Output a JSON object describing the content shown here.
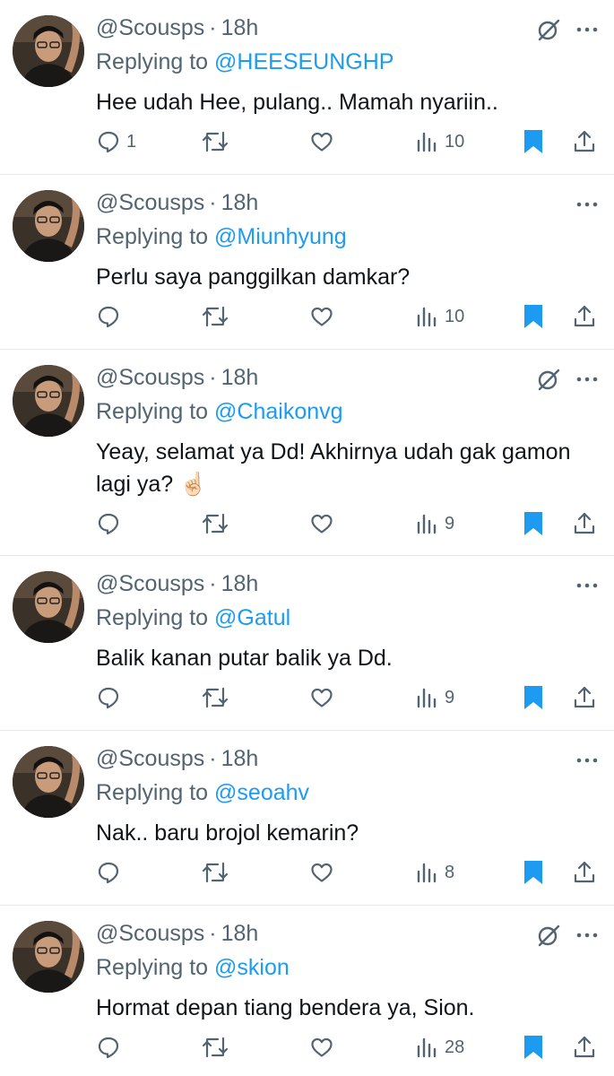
{
  "colors": {
    "accent": "#1d9bf0",
    "muted": "#536471",
    "text": "#0f1419",
    "divider": "#e6e9eb"
  },
  "icons": [
    "reply-icon",
    "retweet-icon",
    "like-icon",
    "views-icon",
    "bookmark-icon",
    "share-icon",
    "grok-icon",
    "more-icon"
  ],
  "tweets": [
    {
      "handle": "@Scousps",
      "sep": "·",
      "time": "18h",
      "replying_prefix": "Replying to",
      "replying_to": "@HEESEUNGHP",
      "text": "Hee udah Hee, pulang.. Mamah nyariin..",
      "replies": "1",
      "retweets": "",
      "likes": "",
      "views": "10",
      "bookmarked": true,
      "show_grok": true
    },
    {
      "handle": "@Scousps",
      "sep": "·",
      "time": "18h",
      "replying_prefix": "Replying to",
      "replying_to": "@Miunhyung",
      "text": "Perlu saya panggilkan damkar?",
      "replies": "",
      "retweets": "",
      "likes": "",
      "views": "10",
      "bookmarked": true,
      "show_grok": false
    },
    {
      "handle": "@Scousps",
      "sep": "·",
      "time": "18h",
      "replying_prefix": "Replying to",
      "replying_to": "@Chaikonvg",
      "text": "Yeay, selamat ya Dd! Akhirnya udah gak gamon lagi ya? ☝🏻",
      "replies": "",
      "retweets": "",
      "likes": "",
      "views": "9",
      "bookmarked": true,
      "show_grok": true
    },
    {
      "handle": "@Scousps",
      "sep": "·",
      "time": "18h",
      "replying_prefix": "Replying to",
      "replying_to": "@Gatul",
      "text": "Balik kanan putar balik ya Dd.",
      "replies": "",
      "retweets": "",
      "likes": "",
      "views": "9",
      "bookmarked": true,
      "show_grok": false
    },
    {
      "handle": "@Scousps",
      "sep": "·",
      "time": "18h",
      "replying_prefix": "Replying to",
      "replying_to": "@seoahv",
      "text": "Nak.. baru brojol kemarin?",
      "replies": "",
      "retweets": "",
      "likes": "",
      "views": "8",
      "bookmarked": true,
      "show_grok": false
    },
    {
      "handle": "@Scousps",
      "sep": "·",
      "time": "18h",
      "replying_prefix": "Replying to",
      "replying_to": "@skion",
      "text": "Hormat depan tiang bendera ya, Sion.",
      "replies": "",
      "retweets": "",
      "likes": "",
      "views": "28",
      "bookmarked": true,
      "show_grok": true
    }
  ]
}
